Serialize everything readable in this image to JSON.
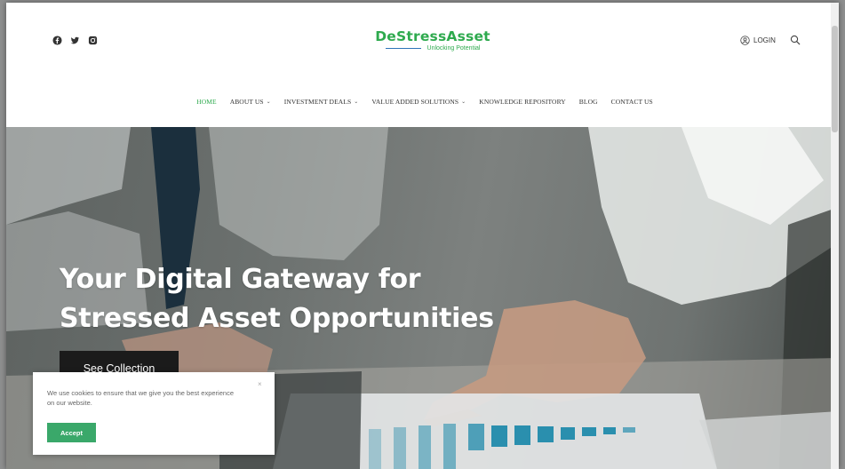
{
  "header": {
    "social_icons": [
      "facebook-icon",
      "twitter-icon",
      "instagram-icon"
    ],
    "logo_title": "DeStressAsset",
    "logo_subtitle": "Unlocking Potential",
    "login_label": "LOGIN"
  },
  "nav": {
    "items": [
      {
        "label": "HOME",
        "active": true,
        "dropdown": false
      },
      {
        "label": "ABOUT US",
        "active": false,
        "dropdown": true
      },
      {
        "label": "INVESTMENT DEALS",
        "active": false,
        "dropdown": true
      },
      {
        "label": "VALUE ADDED SOLUTIONS",
        "active": false,
        "dropdown": true
      },
      {
        "label": "KNOWLEDGE REPOSITORY",
        "active": false,
        "dropdown": false
      },
      {
        "label": "BLOG",
        "active": false,
        "dropdown": false
      },
      {
        "label": "CONTACT US",
        "active": false,
        "dropdown": false
      }
    ],
    "dropdown_glyph": "⌄"
  },
  "hero": {
    "title_line1": "Your Digital Gateway for",
    "title_line2": "Stressed Asset Opportunities",
    "cta_label": "See Collection"
  },
  "cookie": {
    "message": "We use cookies to ensure that we give you the best experience on our website.",
    "accept_label": "Accept",
    "close_glyph": "×"
  },
  "colors": {
    "brand_green": "#2eaa4e",
    "accent_blue": "#2e74b8",
    "accept_green": "#3aa86a",
    "cta_black": "#1b1b1b"
  }
}
